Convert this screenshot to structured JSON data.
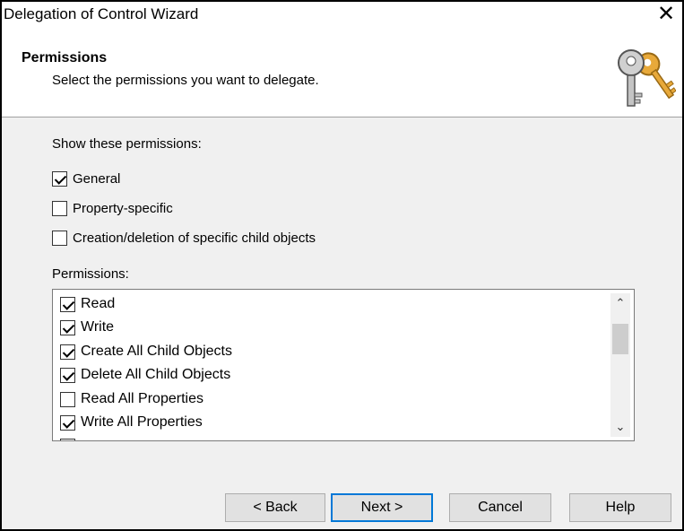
{
  "window": {
    "title": "Delegation of Control Wizard",
    "close_glyph": "✕"
  },
  "header": {
    "title": "Permissions",
    "subtitle": "Select the permissions you want to delegate.",
    "icon": "keys-icon"
  },
  "show_permissions": {
    "label": "Show these permissions:",
    "options": [
      {
        "label": "General",
        "checked": true
      },
      {
        "label": "Property-specific",
        "checked": false
      },
      {
        "label": "Creation/deletion of specific child objects",
        "checked": false
      }
    ]
  },
  "permissions": {
    "label": "Permissions:",
    "items": [
      {
        "label": "Read",
        "checked": true
      },
      {
        "label": "Write",
        "checked": true
      },
      {
        "label": "Create All Child Objects",
        "checked": true
      },
      {
        "label": "Delete All Child Objects",
        "checked": true
      },
      {
        "label": "Read All Properties",
        "checked": false
      },
      {
        "label": "Write All Properties",
        "checked": true
      }
    ],
    "scroll_up_glyph": "⌃",
    "scroll_down_glyph": "⌄"
  },
  "buttons": {
    "back": "< Back",
    "next": "Next >",
    "cancel": "Cancel",
    "help": "Help"
  },
  "colors": {
    "default_button_border": "#0078d7",
    "key_gold": "#e8a93a",
    "key_silver": "#b8b8b8"
  }
}
